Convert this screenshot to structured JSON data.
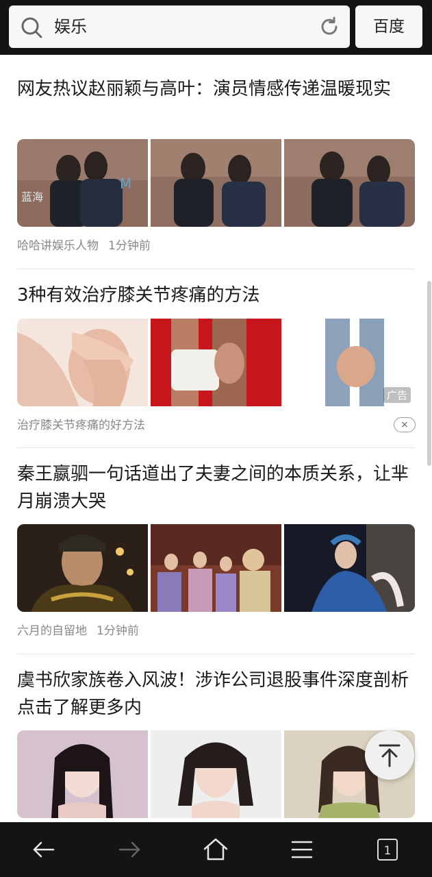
{
  "search": {
    "query": "娱乐",
    "button_label": "百度"
  },
  "feed": {
    "items": [
      {
        "title": "网友热议赵丽颖与高叶：演员情感传递温暖现实",
        "source": "哈哈讲娱乐人物",
        "time": "1分钟前"
      },
      {
        "title": "3种有效治疗膝关节疼痛的方法",
        "source": "治疗膝关节疼痛的好方法",
        "ad_label": "广告",
        "close_symbol": "×"
      },
      {
        "title": "秦王嬴驷一句话道出了夫妻之间的本质关系，让芈月崩溃大哭",
        "source": "六月的自留地",
        "time": "1分钟前"
      },
      {
        "title": "虞书欣家族卷入风波！涉诈公司退股事件深度剖析点击了解更多内",
        "source": "",
        "time": ""
      }
    ]
  },
  "bottom_nav": {
    "tab_count": "1"
  },
  "icons": {
    "search": "search-icon",
    "refresh": "refresh-icon",
    "back_to_top": "arrow-up-to-top-icon",
    "back": "arrow-left-icon",
    "forward": "arrow-right-icon",
    "home": "home-icon",
    "menu": "menu-icon",
    "tabs": "tabs-icon"
  }
}
